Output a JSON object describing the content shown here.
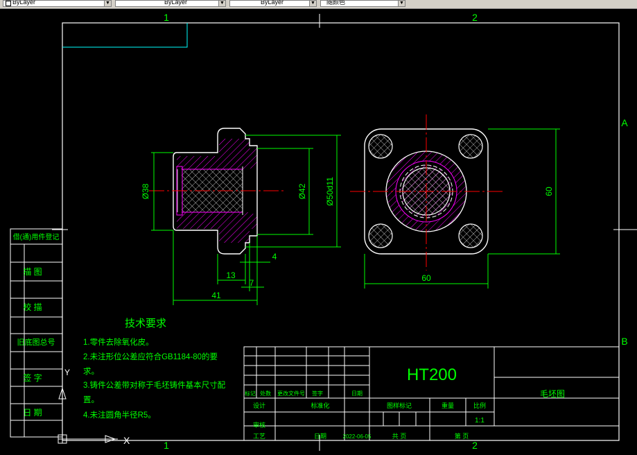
{
  "toolbar": {
    "layer_combo": "ByLayer",
    "linetype_combo": "ByLayer",
    "lineweight_combo": "ByLayer",
    "color_combo": "随颜色"
  },
  "frame": {
    "zone_top_1": "1",
    "zone_top_2": "2",
    "zone_bottom_1": "1",
    "zone_bottom_2": "2",
    "zone_right_a": "A",
    "zone_right_b": "B"
  },
  "side_panel": {
    "row1": "借(通)用件登记",
    "row2": "描 图",
    "row3": "校 描",
    "row4": "旧底图总号",
    "row5": "签 字",
    "row6": "日 期"
  },
  "dimensions": {
    "d38": "Ø38",
    "d42": "Ø42",
    "d50": "Ø50d11",
    "len41": "41",
    "len13": "13",
    "len7": "7",
    "len4": "4",
    "w60": "60",
    "h60": "60"
  },
  "tech_requirements": {
    "title": "技术要求",
    "line1": "1.零件去除氧化皮。",
    "line2a": "2.未注形位公差应符合GB1184-80的要",
    "line2b": "求。",
    "line3a": "3.铸件公差带对称于毛坯铸件基本尺寸配",
    "line3b": "置。",
    "line4": "4.未注圆角半径R5。"
  },
  "title_block": {
    "material": "HT200",
    "drawing_name": "毛坯图",
    "mark": "标记",
    "count": "处数",
    "change_doc": "更改文件号",
    "sign": "签字",
    "date": "日期",
    "design": "设计",
    "standardize": "标准化",
    "stage_mark": "图样标记",
    "weight": "重量",
    "scale_label": "比例",
    "scale_value": "1:1",
    "review": "审核",
    "process": "工艺",
    "date2": "日期",
    "date_value": "2022-06-05",
    "total": "共 页",
    "sheet": "第 页"
  },
  "ucs": {
    "y_label": "Y",
    "x_label": "X"
  },
  "colors": {
    "background": "#000000",
    "outline": "#ffffff",
    "dimension": "#00ff00",
    "center_line": "#ff0000",
    "hatch": "#ff00ff",
    "frame": "#00ffff"
  }
}
